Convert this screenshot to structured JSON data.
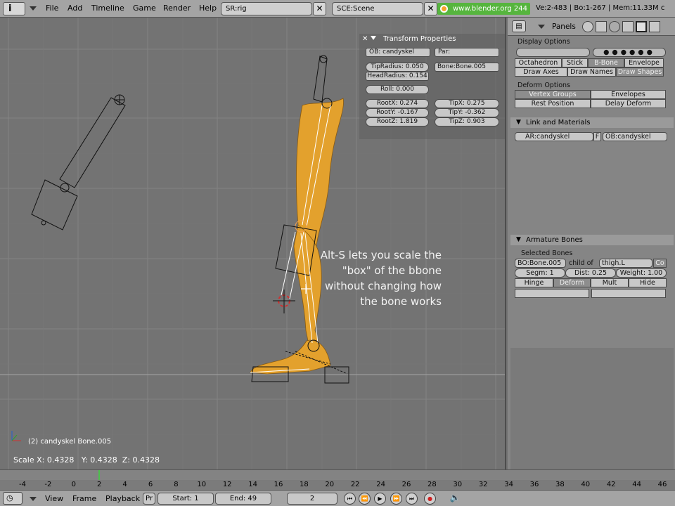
{
  "menu": {
    "items": [
      "File",
      "Add",
      "Timeline",
      "Game",
      "Render",
      "Help"
    ]
  },
  "screen_field": "SR:rig",
  "scene_field": "SCE:Scene",
  "url": "www.blender.org 244",
  "stats": "Ve:2-483 | Bo:1-267 | Mem:11.33M c",
  "transform": {
    "title": "Transform Properties",
    "ob": "OB: candyskel",
    "par": "Par:",
    "tip_radius": "TipRadius: 0.050",
    "head_radius": "HeadRadius: 0.154",
    "bone": "Bone:Bone.005",
    "roll": "Roll: 0.000",
    "rootx": "RootX: 0.274",
    "rooty": "RootY: -0.167",
    "rootz": "RootZ: 1.819",
    "tipx": "TipX: 0.275",
    "tipy": "TipY: -0.362",
    "tipz": "TipZ: 0.903"
  },
  "viewport": {
    "object_label": "(2) candyskel Bone.005",
    "scale_readout": "Scale X: 0.4328   Y: 0.4328  Z: 0.4328",
    "overlay_lines": [
      "Alt-S lets you scale the",
      "\"box\" of the bbone",
      "without changing how",
      "the bone works"
    ]
  },
  "panels": {
    "label": "Panels",
    "display_options": "Display Options",
    "draw_types": [
      "Octahedron",
      "Stick",
      "B-Bone",
      "Envelope"
    ],
    "draw_axes": "Draw Axes",
    "draw_names": "Draw Names",
    "draw_shapes": "Draw Shapes",
    "deform_options": "Deform Options",
    "vertex_groups": "Vertex Groups",
    "envelopes": "Envelopes",
    "rest_position": "Rest Position",
    "delay_deform": "Delay Deform",
    "link_materials": "Link and Materials",
    "ar": "AR:candyskel",
    "f": "F",
    "ob": "OB:candyskel",
    "armature_bones": "Armature Bones",
    "selected_bones": "Selected Bones",
    "bo": "BO:Bone.005",
    "child_of": "child of",
    "parent": "thigh.L",
    "co": "Co",
    "segm": "Segm: 1",
    "dist": "Dist: 0.25",
    "weight": "Weight: 1.00",
    "hinge": "Hinge",
    "deform": "Deform",
    "mult": "Mult",
    "hide": "Hide"
  },
  "timeline": {
    "ticks": [
      "-4",
      "-2",
      "0",
      "2",
      "4",
      "6",
      "8",
      "10",
      "12",
      "14",
      "16",
      "18",
      "20",
      "22",
      "24",
      "26",
      "28",
      "30",
      "32",
      "34",
      "36",
      "38",
      "40",
      "42",
      "44",
      "46"
    ],
    "current_frame_marker": "2"
  },
  "bottom": {
    "view": "View",
    "frame": "Frame",
    "playback": "Playback",
    "pr": "Pr",
    "start": "Start: 1",
    "end": "End: 49",
    "current": "2"
  },
  "colors": {
    "accent_green": "#56b53e",
    "leg_orange": "#e3a12d",
    "bg": "#737373"
  }
}
